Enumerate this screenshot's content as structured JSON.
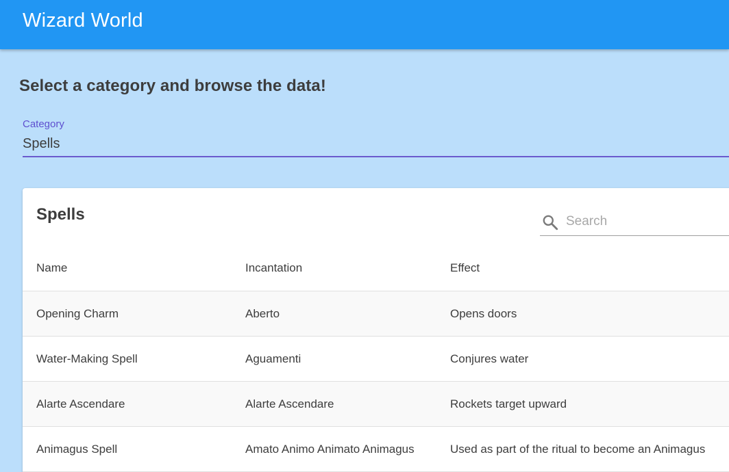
{
  "app": {
    "title": "Wizard World"
  },
  "page": {
    "heading": "Select a category and browse the data!"
  },
  "category": {
    "label": "Category",
    "value": "Spells"
  },
  "card": {
    "title": "Spells",
    "search": {
      "placeholder": "Search",
      "value": "",
      "icon": "search-icon"
    },
    "columns": [
      "Name",
      "Incantation",
      "Effect"
    ],
    "rows": [
      [
        "Opening Charm",
        "Aberto",
        "Opens doors"
      ],
      [
        "Water-Making Spell",
        "Aguamenti",
        "Conjures water"
      ],
      [
        "Alarte Ascendare",
        "Alarte Ascendare",
        "Rockets target upward"
      ],
      [
        "Animagus Spell",
        "Amato Animo Animato Animagus",
        "Used as part of the ritual to become an Animagus"
      ]
    ]
  },
  "colors": {
    "app_bar": "#2196f3",
    "background": "#bbdefb",
    "accent": "#6a5acd"
  }
}
